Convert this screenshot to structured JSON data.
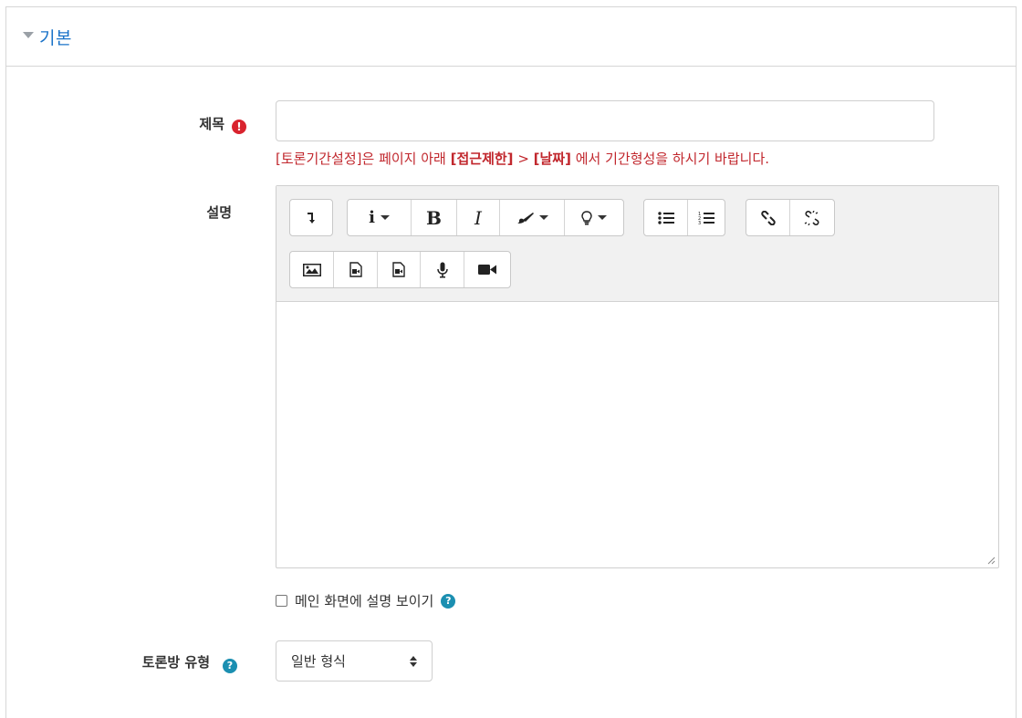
{
  "section": {
    "title": "기본"
  },
  "fields": {
    "title_label": "제목",
    "title_value": "",
    "notice": {
      "part1": "[토론기간설정]은 페이지 아래 ",
      "bold1": "[접근제한]",
      "part2": " > ",
      "bold2": "[날짜]",
      "part3": " 에서 기간형성을 하시기 바랍니다."
    },
    "description_label": "설명",
    "show_on_main_label": "메인 화면에 설명 보이기",
    "forum_type_label": "토론방 유형",
    "forum_type_value": "일반 형식"
  },
  "editor": {
    "toolbar_row1": [
      {
        "group": "toggle",
        "buttons": [
          "collapse-icon"
        ]
      },
      {
        "group": "style",
        "buttons": [
          "info-dropdown-icon",
          "bold-icon",
          "italic-icon",
          "brush-dropdown-icon",
          "lightbulb-dropdown-icon"
        ]
      },
      {
        "group": "list",
        "buttons": [
          "unordered-list-icon",
          "ordered-list-icon"
        ]
      },
      {
        "group": "links",
        "buttons": [
          "link-icon",
          "unlink-icon"
        ]
      }
    ],
    "toolbar_row2": [
      {
        "group": "media",
        "buttons": [
          "image-icon",
          "media-file-icon",
          "media-file-alt-icon",
          "microphone-icon",
          "video-camera-icon"
        ]
      }
    ],
    "bold_glyph": "B",
    "italic_glyph": "I",
    "info_glyph": "i"
  },
  "colors": {
    "accent": "#1a73c8",
    "required": "#d9232e",
    "notice": "#c1272d",
    "help": "#1b8fb1"
  }
}
